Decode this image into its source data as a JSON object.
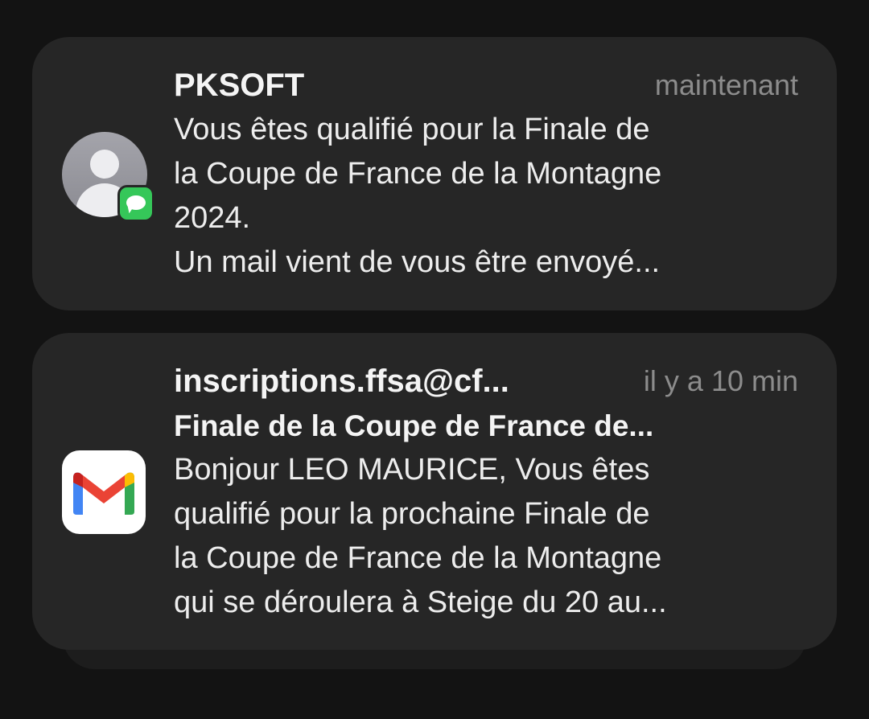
{
  "notifications": [
    {
      "app_icon": "contact-avatar-with-messages-badge-icon",
      "title": "PKSOFT",
      "time": "maintenant",
      "lines": [
        "Vous êtes qualifié pour la Finale de",
        "la Coupe de France de la Montagne",
        "2024.",
        "Un mail vient de vous être envoyé..."
      ]
    },
    {
      "app_icon": "gmail-icon",
      "title": "inscriptions.ffsa@cf...",
      "time": "il y a 10 min",
      "subject": "Finale de la Coupe de France de...",
      "lines": [
        "Bonjour LEO MAURICE, Vous êtes",
        "qualifié pour la prochaine Finale de",
        "la Coupe de France de la Montagne",
        "qui se déroulera à Steige du 20 au..."
      ]
    }
  ],
  "colors": {
    "background": "#131313",
    "card": "#262626",
    "title_text": "#f4f4f4",
    "secondary_text": "#8c8c8c",
    "messages_green": "#35c759",
    "gmail_red": "#EA4335",
    "gmail_blue": "#4285F4",
    "gmail_green": "#34A853",
    "gmail_yellow": "#FBBC04"
  }
}
